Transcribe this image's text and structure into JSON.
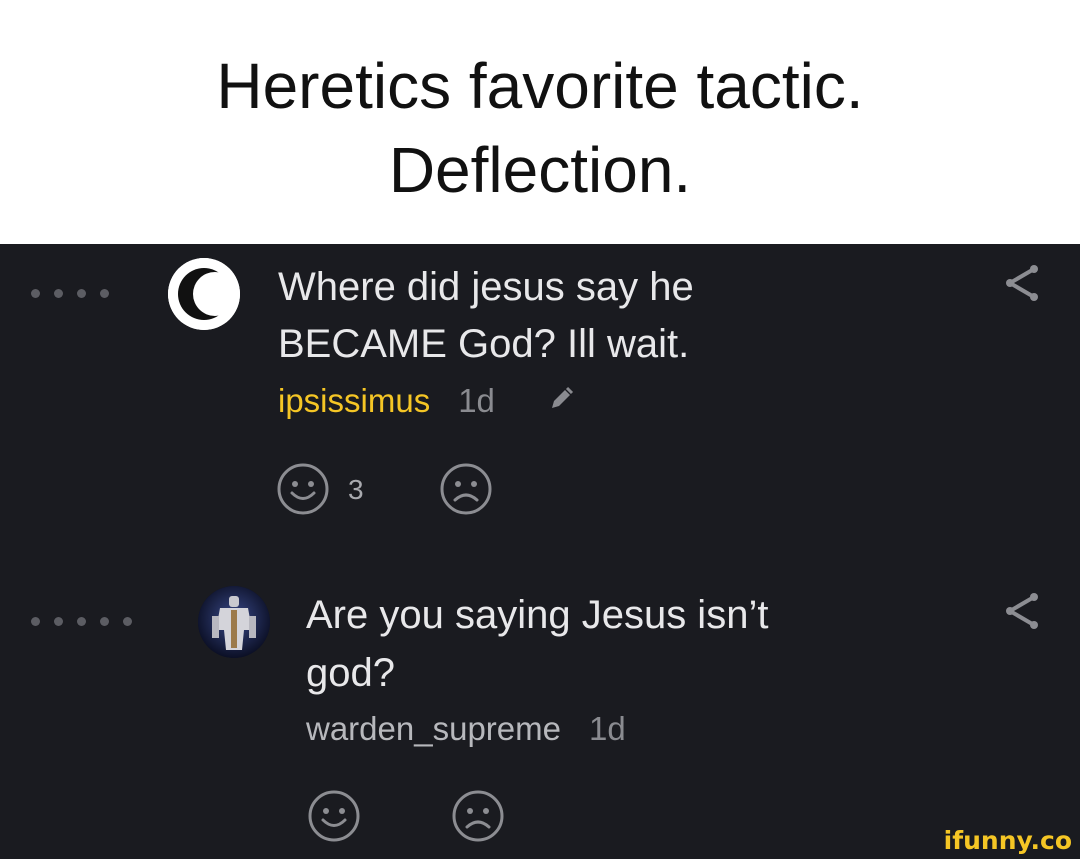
{
  "caption": {
    "line1": "Heretics favorite tactic.",
    "line2": "Deflection."
  },
  "comments": [
    {
      "line1": "Where did jesus say he",
      "line2": "BECAME God? Ill wait.",
      "username": "ipsissimus",
      "time": "1d",
      "edited_icon": "pencil-icon",
      "smile_count": "3",
      "avatar": "crescent-moon",
      "username_color": "#f5c625"
    },
    {
      "line1": "Are you saying Jesus isn’t",
      "line2": "god?",
      "username": "warden_supreme",
      "time": "1d",
      "smile_count": "",
      "avatar": "armored-knight",
      "username_color": "#b7b8bc"
    }
  ],
  "watermark": "ifunny.co",
  "colors": {
    "background": "#1a1b20",
    "caption_background": "#ffffff",
    "accent": "#f5c625",
    "icon": "#8c8d92"
  }
}
